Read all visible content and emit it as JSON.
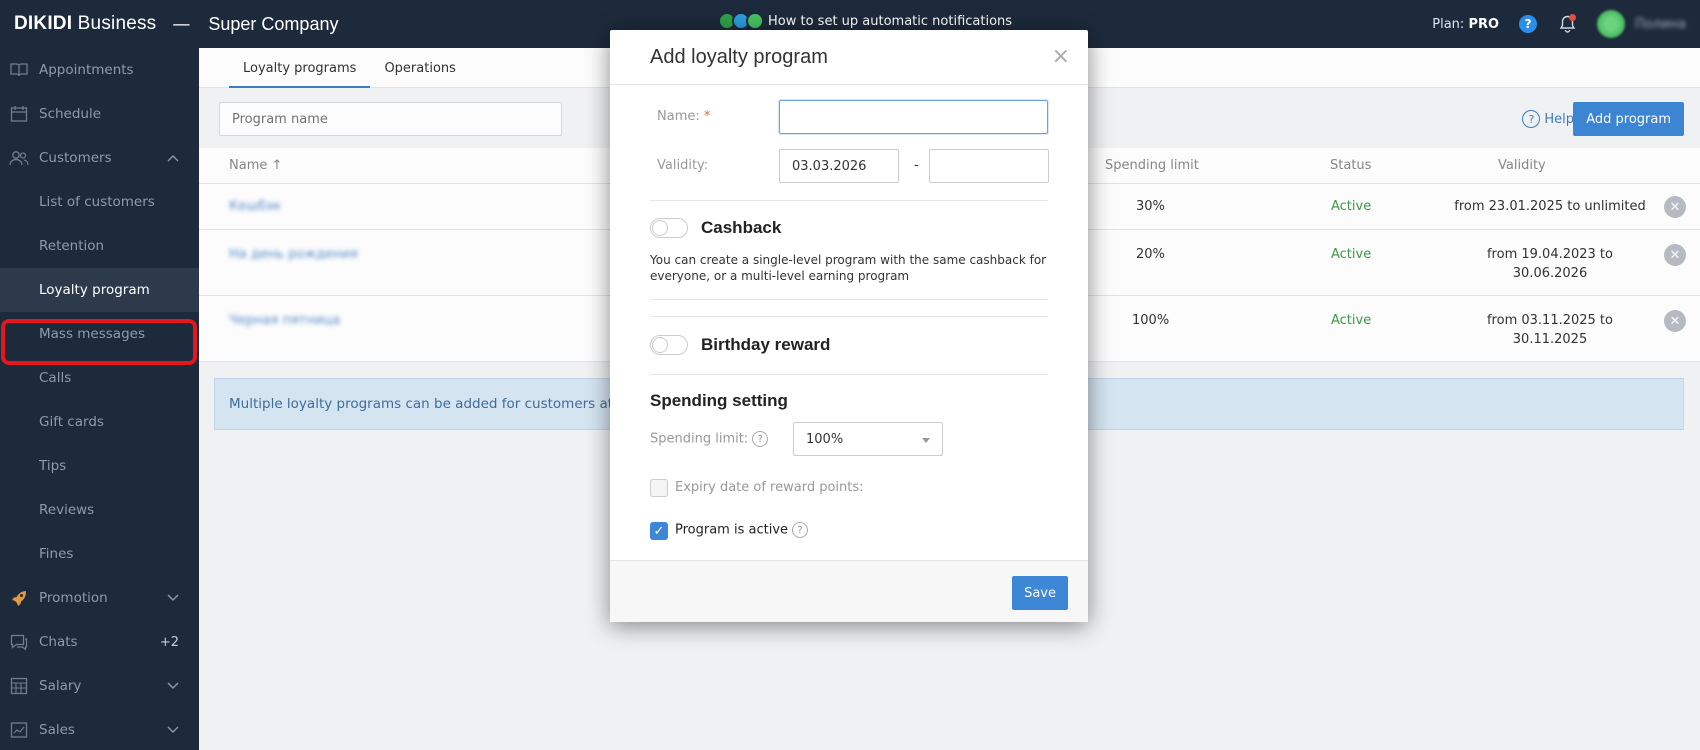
{
  "topbar": {
    "brand_bold": "DIKIDI",
    "brand_rest": " Business",
    "dash": "—",
    "company": "Super Company",
    "promo_text": "How to set up automatic notifications",
    "plan_label": "Plan:",
    "plan_value": "PRO",
    "help_glyph": "?",
    "user_name": "Полина"
  },
  "sidebar": {
    "items": [
      {
        "label": "Appointments",
        "icon": "book-icon"
      },
      {
        "label": "Schedule",
        "icon": "calendar-icon"
      },
      {
        "label": "Customers",
        "icon": "users-icon"
      },
      {
        "label": "List of customers"
      },
      {
        "label": "Retention"
      },
      {
        "label": "Loyalty program"
      },
      {
        "label": "Mass messages"
      },
      {
        "label": "Calls"
      },
      {
        "label": "Gift cards"
      },
      {
        "label": "Tips"
      },
      {
        "label": "Reviews"
      },
      {
        "label": "Fines"
      },
      {
        "label": "Promotion",
        "icon": "rocket-icon"
      },
      {
        "label": "Chats",
        "icon": "chat-icon",
        "badge": "+2"
      },
      {
        "label": "Salary",
        "icon": "salary-icon"
      },
      {
        "label": "Sales",
        "icon": "sales-icon"
      }
    ]
  },
  "main": {
    "tabs": [
      {
        "label": "Loyalty programs"
      },
      {
        "label": "Operations"
      }
    ],
    "search_placeholder": "Program name",
    "help_label": "Help",
    "add_button": "Add program",
    "columns": {
      "name": "Name ↑",
      "spending_limit": "Spending limit",
      "status": "Status",
      "validity": "Validity"
    },
    "rows": [
      {
        "name": "Кешбэк",
        "spending": "30%",
        "status": "Active",
        "validity_1": "from 23.01.2025 to unlimited",
        "validity_2": ""
      },
      {
        "name": "На день рождения",
        "spending": "20%",
        "status": "Active",
        "validity_1": "from 19.04.2023 to",
        "validity_2": "30.06.2026"
      },
      {
        "name": "Черная пятница",
        "spending": "100%",
        "status": "Active",
        "validity_1": "from 03.11.2025 to",
        "validity_2": "30.11.2025"
      }
    ],
    "info_text": "Multiple loyalty programs can be added for customers at once."
  },
  "modal": {
    "title": "Add loyalty program",
    "close_glyph": "×",
    "name_label": "Name:",
    "name_required": "*",
    "name_value": "",
    "validity_label": "Validity:",
    "validity_from": "03.03.2026",
    "validity_dash": "-",
    "validity_to": "",
    "cashback_title": "Cashback",
    "cashback_enabled": false,
    "cashback_desc": "You can create a single-level program with the same cashback for everyone, or a multi-level earning program",
    "birthday_title": "Birthday reward",
    "birthday_enabled": false,
    "spending_title": "Spending setting",
    "spending_limit_label": "Spending limit:",
    "spending_limit_value": "100%",
    "expiry_label": "Expiry date of reward points:",
    "expiry_checked": false,
    "active_label": "Program is active",
    "active_checked": true,
    "save_button": "Save"
  },
  "colors": {
    "topbar_bg": "#1d2a3b",
    "accent": "#3d87d6",
    "status_active": "#3e9b49",
    "highlight_border": "#e5161c"
  }
}
